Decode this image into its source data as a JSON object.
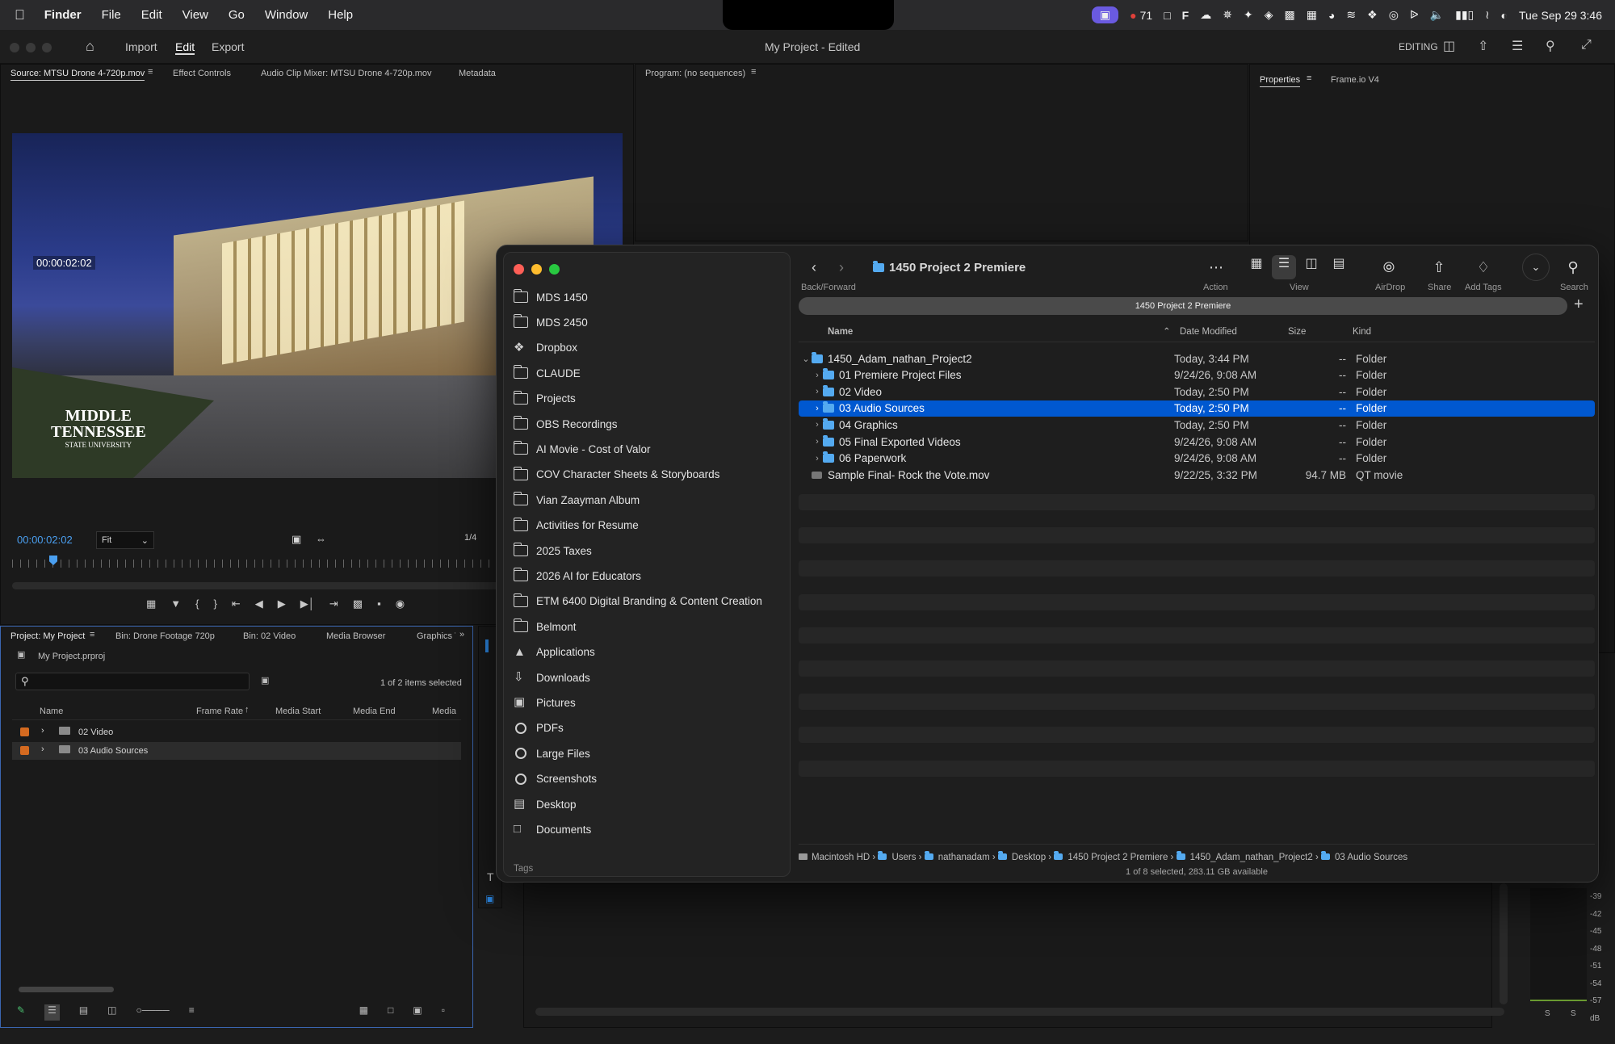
{
  "menubar": {
    "app": "Finder",
    "items": [
      "File",
      "Edit",
      "View",
      "Go",
      "Window",
      "Help"
    ],
    "record_count": "71",
    "clock": "Tue Sep 29  3:46"
  },
  "premiere": {
    "nav": {
      "import": "Import",
      "edit": "Edit",
      "export": "Export"
    },
    "title": "My Project - Edited",
    "workspace": "EDITING",
    "source_tabs": [
      "Source: MTSU Drone 4-720p.mov",
      "Effect Controls",
      "Audio Clip Mixer: MTSU Drone 4-720p.mov",
      "Metadata"
    ],
    "program_tab": "Program: (no sequences)",
    "right_tabs": [
      "Properties",
      "Frame.io V4"
    ],
    "overlay_timecode": "00:00:02:02",
    "logo_line1": "MIDDLE",
    "logo_line2": "TENNESSEE",
    "logo_line3": "STATE UNIVERSITY",
    "timecode": "00:00:02:02",
    "fit": "Fit",
    "fraction": "1/4",
    "project_tabs": [
      "Project: My Project",
      "Bin: Drone Footage 720p",
      "Bin: 02 Video",
      "Media Browser",
      "Graphics T"
    ],
    "project_file": "My Project.prproj",
    "selection_info": "1 of 2 items selected",
    "columns": [
      "Name",
      "Frame Rate",
      "Media Start",
      "Media End",
      "Media"
    ],
    "bins": [
      "02 Video",
      "03 Audio Sources"
    ],
    "meter_labels": [
      "-39",
      "-42",
      "-45",
      "-48",
      "-51",
      "-54",
      "-57",
      "dB"
    ],
    "meter_s": [
      "S",
      "S"
    ],
    "accent": "#2d8ceb"
  },
  "finder": {
    "title": "1450 Project 2 Premiere",
    "toolbar": {
      "back_forward": "Back/Forward",
      "action": "Action",
      "view": "View",
      "airdrop": "AirDrop",
      "share": "Share",
      "add_tags": "Add Tags",
      "search": "Search"
    },
    "tab_label": "1450 Project 2 Premiere",
    "sidebar": [
      {
        "label": "MDS 1450",
        "icon": "folder-icon"
      },
      {
        "label": "MDS 2450",
        "icon": "folder-icon"
      },
      {
        "label": "Dropbox",
        "icon": "dropbox-icon"
      },
      {
        "label": "CLAUDE",
        "icon": "folder-icon"
      },
      {
        "label": "Projects",
        "icon": "folder-icon"
      },
      {
        "label": "OBS Recordings",
        "icon": "folder-icon"
      },
      {
        "label": "AI Movie - Cost of Valor",
        "icon": "folder-icon"
      },
      {
        "label": "COV Character Sheets & Storyboards",
        "icon": "folder-icon"
      },
      {
        "label": "Vian Zaayman Album",
        "icon": "folder-icon"
      },
      {
        "label": "Activities for Resume",
        "icon": "folder-icon"
      },
      {
        "label": "2025 Taxes",
        "icon": "folder-icon"
      },
      {
        "label": "2026 AI for Educators",
        "icon": "folder-icon"
      },
      {
        "label": "ETM 6400 Digital Branding & Content Creation",
        "icon": "folder-icon"
      },
      {
        "label": "Belmont",
        "icon": "folder-icon"
      },
      {
        "label": "Applications",
        "icon": "applications-icon"
      },
      {
        "label": "Downloads",
        "icon": "downloads-icon"
      },
      {
        "label": "Pictures",
        "icon": "pictures-icon"
      },
      {
        "label": "PDFs",
        "icon": "gear-icon"
      },
      {
        "label": "Large Files",
        "icon": "gear-icon"
      },
      {
        "label": "Screenshots",
        "icon": "gear-icon"
      },
      {
        "label": "Desktop",
        "icon": "desktop-icon"
      },
      {
        "label": "Documents",
        "icon": "documents-icon"
      }
    ],
    "tags_label": "Tags",
    "columns": {
      "name": "Name",
      "date": "Date Modified",
      "size": "Size",
      "kind": "Kind"
    },
    "rows": [
      {
        "name": "1450_Adam_nathan_Project2",
        "date": "Today, 3:44 PM",
        "size": "--",
        "kind": "Folder",
        "level": 0,
        "open": true
      },
      {
        "name": "01 Premiere Project Files",
        "date": "9/24/26, 9:08 AM",
        "size": "--",
        "kind": "Folder",
        "level": 1
      },
      {
        "name": "02 Video",
        "date": "Today, 2:50 PM",
        "size": "--",
        "kind": "Folder",
        "level": 1
      },
      {
        "name": "03 Audio Sources",
        "date": "Today, 2:50 PM",
        "size": "--",
        "kind": "Folder",
        "level": 1,
        "selected": true
      },
      {
        "name": "04 Graphics",
        "date": "Today, 2:50 PM",
        "size": "--",
        "kind": "Folder",
        "level": 1
      },
      {
        "name": "05 Final Exported Videos",
        "date": "9/24/26, 9:08 AM",
        "size": "--",
        "kind": "Folder",
        "level": 1
      },
      {
        "name": "06 Paperwork",
        "date": "9/24/26, 9:08 AM",
        "size": "--",
        "kind": "Folder",
        "level": 1
      },
      {
        "name": "Sample Final- Rock the Vote.mov",
        "date": "9/22/25, 3:32 PM",
        "size": "94.7 MB",
        "kind": "QT movie",
        "level": 0,
        "file": true
      }
    ],
    "path": [
      "Macintosh HD",
      "Users",
      "nathanadam",
      "Desktop",
      "1450 Project 2 Premiere",
      "1450_Adam_nathan_Project2",
      "03 Audio Sources"
    ],
    "status": "1 of 8 selected, 283.11 GB available",
    "selection_color": "#0058d0",
    "folder_color": "#54aaf0"
  }
}
